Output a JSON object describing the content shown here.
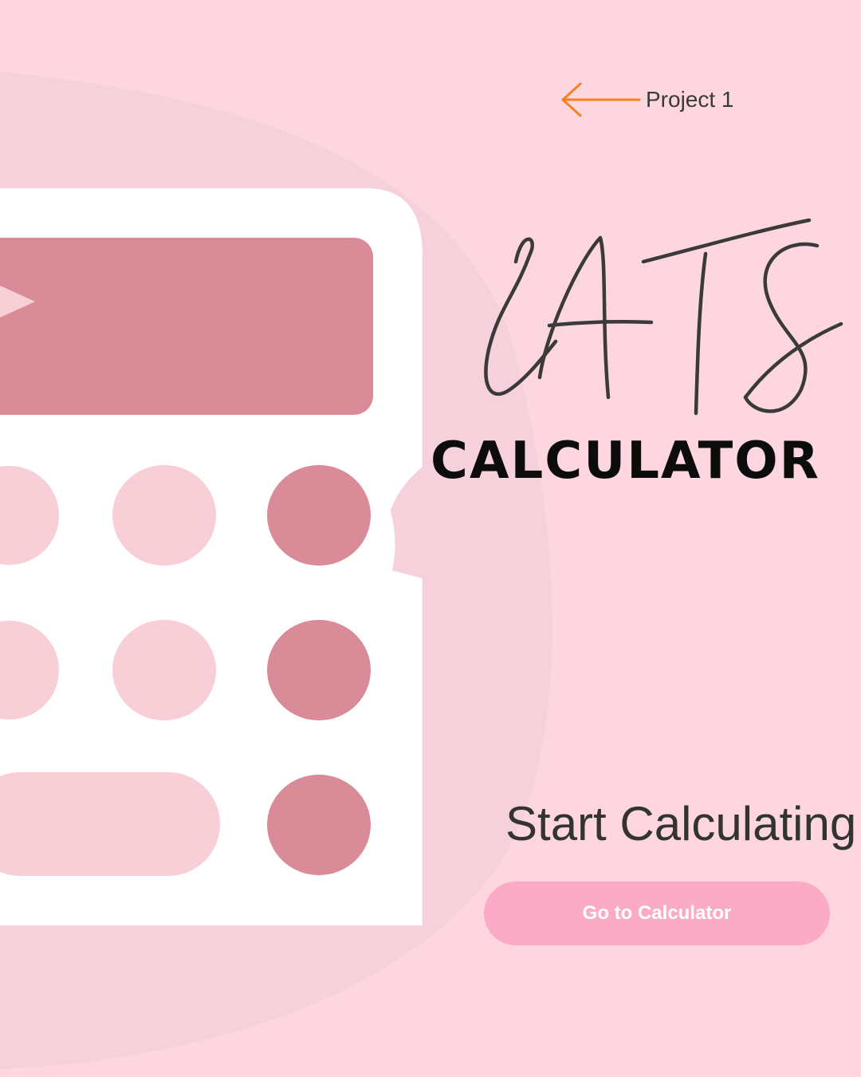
{
  "nav": {
    "back_label": "Project 1",
    "back_icon": "arrow-left-icon",
    "arrow_color": "#f5821f"
  },
  "hero": {
    "logo_script": "CATS",
    "subtitle": "CALCULATOR"
  },
  "cta": {
    "heading": "Start Calculating",
    "button_label": "Go to Calculator"
  },
  "colors": {
    "background": "#fdd6df",
    "blob": "#f6d0da",
    "key_dark": "#d98b98",
    "key_light": "#f8ced7",
    "button": "#fcabc7"
  }
}
